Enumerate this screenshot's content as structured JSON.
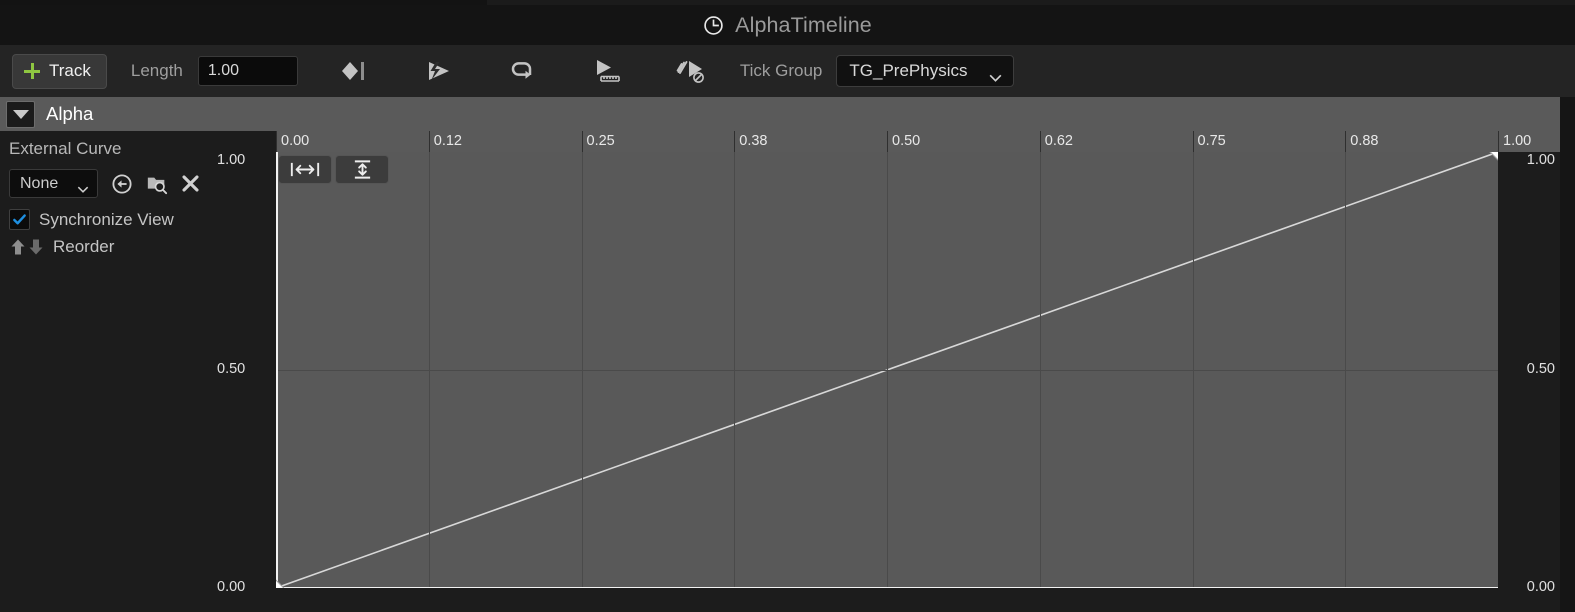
{
  "window": {
    "title": "AlphaTimeline",
    "title_icon": "clock-icon"
  },
  "toolbar": {
    "add_track_label": "Track",
    "add_track_icon": "plus-icon",
    "length_label": "Length",
    "length_value": "1.00",
    "tick_group_label": "Tick Group",
    "tick_group_value": "TG_PrePhysics",
    "icons": [
      {
        "name": "keyframe-marker-icon",
        "title": "Add Keyframe"
      },
      {
        "name": "auto-play-icon",
        "title": "Auto Play"
      },
      {
        "name": "loop-icon",
        "title": "Loop"
      },
      {
        "name": "use-last-keyframe-icon",
        "title": "Use Last Keyframe"
      },
      {
        "name": "ignore-time-dilation-icon",
        "title": "Ignore Time Dilation"
      }
    ]
  },
  "track": {
    "name": "Alpha",
    "expanded": true
  },
  "sidebar": {
    "external_curve_label": "External Curve",
    "curve_value": "None",
    "curve_icons": [
      {
        "name": "use-selected-asset-icon"
      },
      {
        "name": "browse-to-asset-icon"
      },
      {
        "name": "clear-asset-icon"
      }
    ],
    "synchronize_view_label": "Synchronize View",
    "synchronize_view_checked": true,
    "reorder_label": "Reorder",
    "reorder_up_icon": "arrow-up-icon",
    "reorder_down_icon": "arrow-down-icon"
  },
  "graph": {
    "fit_horizontal_label": "[↔]",
    "fit_horizontal_name": "fit-horizontal-button",
    "fit_vertical_name": "fit-vertical-button",
    "accent_checkbox_color": "#1e8fe0",
    "plot_bg_color": "#595959",
    "grid_color": "#4a4a4a",
    "curve_color": "#d8d8d8"
  },
  "chart_data": {
    "type": "line",
    "title": "Alpha",
    "xlabel": "",
    "ylabel": "",
    "xlim": [
      0.0,
      1.0
    ],
    "ylim": [
      0.0,
      1.0
    ],
    "grid": true,
    "legend": "none",
    "x_ticks": [
      "0.00",
      "0.12",
      "0.25",
      "0.38",
      "0.50",
      "0.62",
      "0.75",
      "0.88",
      "1.00"
    ],
    "x_tick_values": [
      0.0,
      0.125,
      0.25,
      0.375,
      0.5,
      0.625,
      0.75,
      0.875,
      1.0
    ],
    "y_ticks_left": [
      "1.00",
      "0.50",
      "0.00"
    ],
    "y_ticks_right": [
      "1.00",
      "0.50",
      "0.00"
    ],
    "y_tick_values": [
      1.0,
      0.5,
      0.0
    ],
    "series": [
      {
        "name": "Alpha",
        "x": [
          0.0,
          1.0
        ],
        "values": [
          0.0,
          1.0
        ],
        "interpolation": "linear",
        "color": "#d8d8d8"
      }
    ],
    "keyframes": [
      {
        "time": 0.0,
        "value": 0.0
      },
      {
        "time": 1.0,
        "value": 1.0
      }
    ]
  }
}
